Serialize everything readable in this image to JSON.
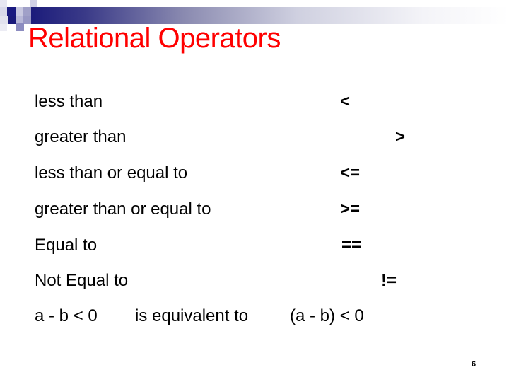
{
  "slide": {
    "title": "Relational Operators",
    "title_color": "#ff0000",
    "page_number": "6"
  },
  "operators": [
    {
      "label": "less than",
      "symbol": "<"
    },
    {
      "label": "greater than",
      "symbol": ">"
    },
    {
      "label": "less than or equal to",
      "symbol": "<="
    },
    {
      "label": "greater than or equal to",
      "symbol": ">="
    },
    {
      "label": "Equal to",
      "symbol": "=="
    },
    {
      "label": "Not Equal to",
      "symbol": "!="
    }
  ],
  "equivalence": {
    "left": "a - b < 0",
    "middle": "is equivalent to",
    "right": "(a - b) < 0"
  },
  "decoration": {
    "header_bar": "gradient-bar-icon",
    "corner_squares": "square-pattern-icon"
  }
}
